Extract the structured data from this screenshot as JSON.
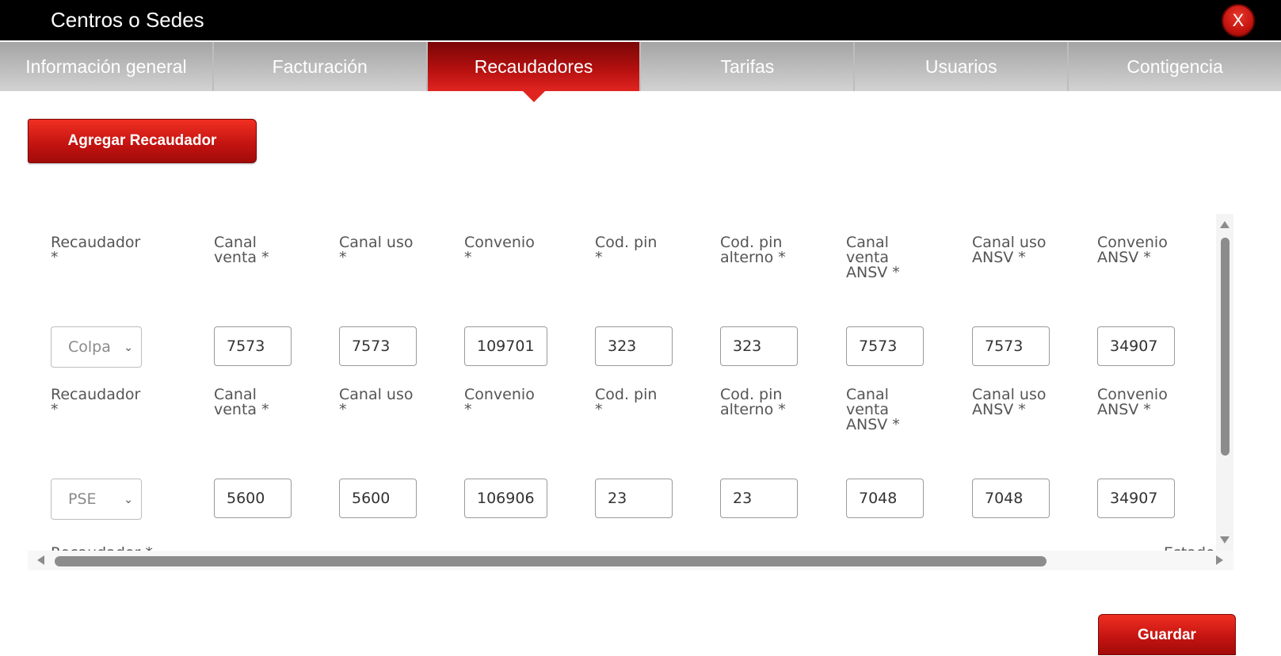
{
  "window": {
    "title": "Centros o Sedes",
    "close_label": "X"
  },
  "tabs": [
    {
      "label": "Información general",
      "active": false
    },
    {
      "label": "Facturación",
      "active": false
    },
    {
      "label": "Recaudadores",
      "active": true
    },
    {
      "label": "Tarifas",
      "active": false
    },
    {
      "label": "Usuarios",
      "active": false
    },
    {
      "label": "Contigencia",
      "active": false
    }
  ],
  "actions": {
    "add_label": "Agregar Recaudador",
    "save_label": "Guardar"
  },
  "columns": [
    "Recaudador\n*",
    "Canal\nventa *",
    "Canal uso\n*",
    "Convenio\n*",
    "Cod. pin\n*",
    "Cod. pin\nalterno *",
    "Canal\nventa\nANSV *",
    "Canal uso\nANSV *",
    "Convenio\nANSV *"
  ],
  "rows": [
    {
      "recaudador": "Colpa",
      "canal_venta": "7573",
      "canal_uso": "7573",
      "convenio": "109701",
      "cod_pin": "323",
      "cod_pin_alterno": "323",
      "canal_venta_ansv": "7573",
      "canal_uso_ansv": "7573",
      "convenio_ansv": "34907"
    },
    {
      "recaudador": "PSE",
      "canal_venta": "5600",
      "canal_uso": "5600",
      "convenio": "106906",
      "cod_pin": "23",
      "cod_pin_alterno": "23",
      "canal_venta_ansv": "7048",
      "canal_uso_ansv": "7048",
      "convenio_ansv": "34907"
    }
  ],
  "partial_row": {
    "recaudador_header": "Recaudador *",
    "estado_header": "Estado"
  },
  "icons": {
    "select_chevron": "chevron-down-icon"
  },
  "colors": {
    "accent": "#c11310",
    "tab_inactive": "#b5b5b5",
    "titlebar": "#000000"
  }
}
